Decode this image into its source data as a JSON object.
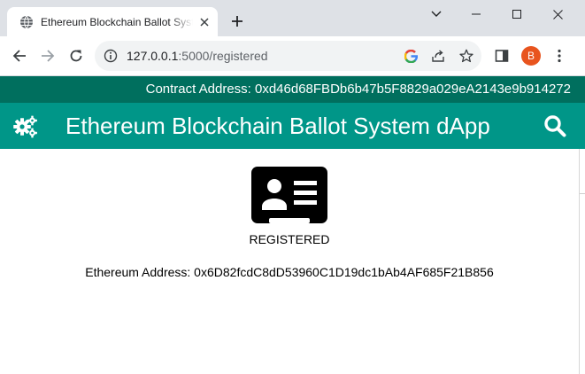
{
  "browser": {
    "tab": {
      "title": "Ethereum Blockchain Ballot System dApp"
    },
    "toolbar": {
      "url_host": "127.0.0.1",
      "url_path": ":5000/registered",
      "avatar_initial": "B"
    }
  },
  "page": {
    "contract_bar": {
      "text": "Contract Address: 0xd46d68FBDb6b47b5F8829a029eA2143e9b914272"
    },
    "navbar": {
      "title": "Ethereum Blockchain Ballot System dApp"
    },
    "status": {
      "label": "REGISTERED"
    },
    "address": {
      "text": "Ethereum Address: 0x6D82fcdC8dD53960C1D19dc1bAb4AF685F21B856"
    }
  },
  "icons": {
    "favicon": "globe-icon",
    "tab_close": "close-icon",
    "new_tab": "plus-icon",
    "back": "arrow-left-icon",
    "forward": "arrow-right-icon",
    "reload": "reload-icon",
    "site_info": "info-icon",
    "google": "google-icon",
    "share": "share-icon",
    "bookmark": "star-icon",
    "side_panel": "side-panel-icon",
    "menu": "kebab-menu-icon",
    "nav_left": "gears-icon",
    "nav_right": "search-icon",
    "status": "id-card-icon"
  },
  "colors": {
    "tab_strip": "#dee1e6",
    "contract_bar": "#006f5e",
    "navbar": "#009688",
    "avatar": "#e8541e",
    "text_white": "#ffffff"
  }
}
